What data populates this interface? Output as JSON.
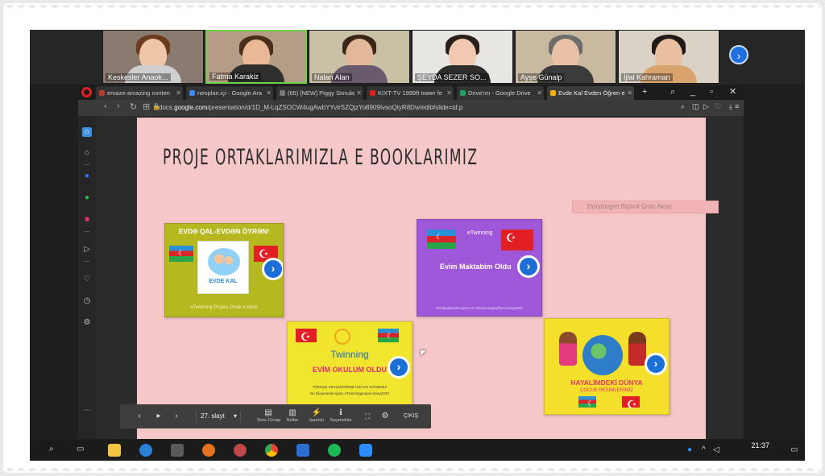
{
  "participants": [
    {
      "name": "Keskesler Anaok...",
      "bg": "#8a7a70",
      "skin": "#f0c6a8",
      "hair": "#6a3b1f",
      "shirt": "#cfcfcf"
    },
    {
      "name": "Fatma Karakiz",
      "bg": "#b59c86",
      "skin": "#e9b896",
      "hair": "#4a2e1c",
      "shirt": "#2f2f2f"
    },
    {
      "name": "Nalan Alan",
      "bg": "#c8c1a6",
      "skin": "#e3b79a",
      "hair": "#3a2618",
      "shirt": "#6a5a6d"
    },
    {
      "name": "ŞEYDA SEZER SO...",
      "bg": "#e8e6e2",
      "skin": "#f0c9b0",
      "hair": "#2a1e18",
      "shirt": "#2d2d2d"
    },
    {
      "name": "Ayşe Günalp",
      "bg": "#c9b9a1",
      "skin": "#e8c1a6",
      "hair": "#6c6c6c",
      "shirt": "#3b3b3b"
    },
    {
      "name": "İjlal Kahraman",
      "bg": "#d9d2c5",
      "skin": "#eac0a0",
      "hair": "#1f1a17",
      "shirt": "#d9a36d"
    }
  ],
  "browser": {
    "tabs": [
      {
        "label": "emaze-amazing conten",
        "color": "#c03a2b"
      },
      {
        "label": "neoplan.içi - Google Ara",
        "color": "#4285f4"
      },
      {
        "label": "(65) [NEW] Piggy Simula",
        "color": "#777777"
      },
      {
        "label": "KIXT-TV 1999ft tower fe",
        "color": "#e02020"
      },
      {
        "label": "Drive'ım - Google Drive",
        "color": "#1fa463"
      },
      {
        "label": "Evde Kal Evden Öğren e",
        "color": "#f4b400"
      }
    ],
    "url_prefix": "docs.",
    "url_domain": "google.com",
    "url_path": "/presentation/d/1D_M-LqZSOCW4ugAwbYYvlrSZQjzYo8909IvsoQtyR8Dw/edit#slide=id.p"
  },
  "slide": {
    "title": "PROJE ORTAKLARIMIZLA E BOOKLARIMIZ",
    "hidden_button": "Döndürgen Biçimli Ürün Aktar",
    "card1": {
      "title": "EVDƏ QAL-EVDƏN ÖYRƏN!",
      "book_title": "EVDE KAL",
      "footer": "eTwinning Projesi Ortak e book"
    },
    "card2": {
      "brand": "eTwinning",
      "title": "Evim Maktabim Oldu",
      "footer": "#evdeqalevdenoyren-ev #etwinninglayihesi-ilmay2020"
    },
    "card3": {
      "brand": "Twinning",
      "title": "EVİM OKULUM OLDU",
      "sub1": "TÜRKÇE SESLENDİRME HİKAYE KİTABIMIZ",
      "sub2": "Bu hikayelerde ilginç eTwinningprojesi ilmay2020"
    },
    "card4": {
      "title": "HAYALİMDEKİ DÜNYA",
      "sub": "ÇOCUK RESİMLERİMİZ"
    }
  },
  "controls": {
    "slide_label": "27. slayt",
    "items": [
      {
        "label": "Soru-Cevap",
        "icon": "chat-icon"
      },
      {
        "label": "Notlar",
        "icon": "notes-icon"
      },
      {
        "label": "İşaretçi",
        "icon": "laser-icon"
      },
      {
        "label": "Seçenekler",
        "icon": "info-icon"
      }
    ],
    "exit_label": "ÇIKIŞ"
  },
  "taskbar": {
    "time": "21:37"
  }
}
